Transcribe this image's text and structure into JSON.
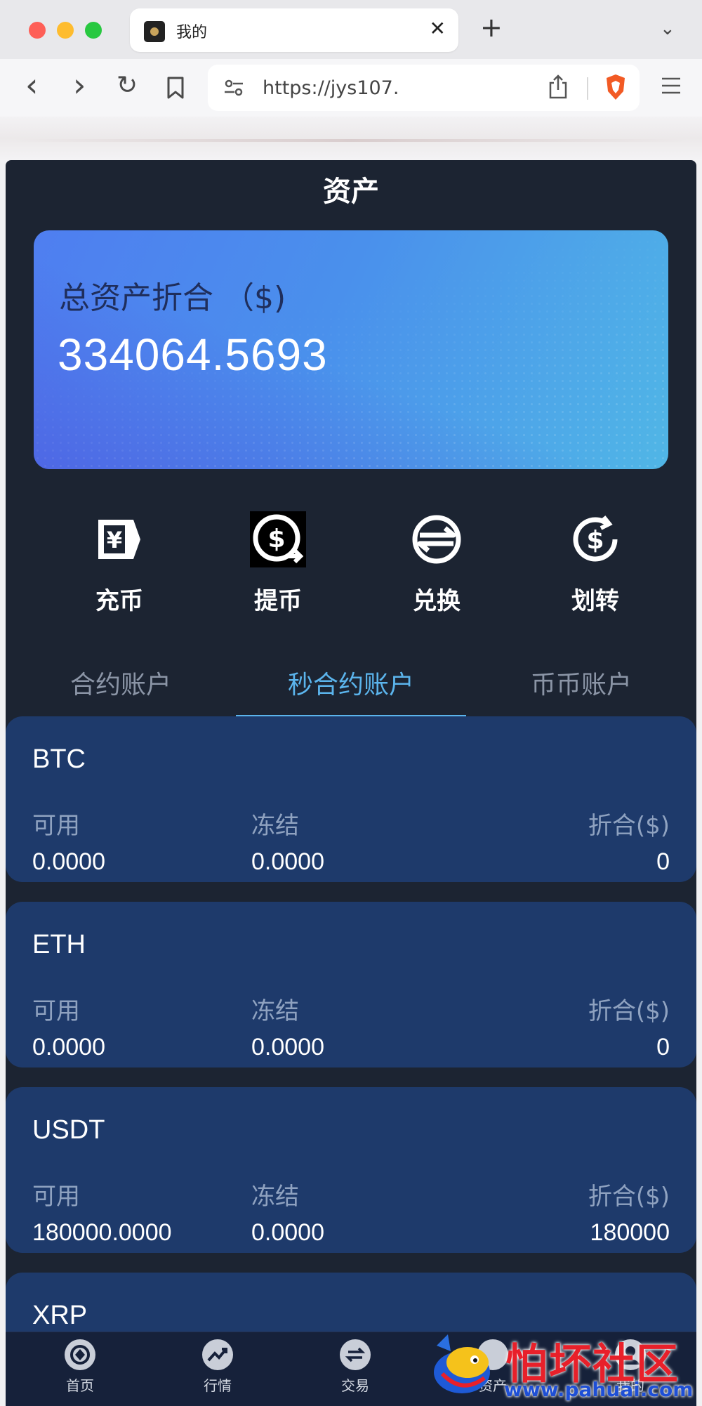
{
  "browser": {
    "tab_title": "我的",
    "close_glyph": "✕",
    "new_tab_glyph": "+",
    "tab_menu_glyph": "⌄",
    "back_glyph": "‹",
    "forward_glyph": "›",
    "reload_glyph": "↻",
    "url": "https://jys107."
  },
  "page": {
    "title": "资产"
  },
  "total": {
    "label": "总资产折合 （$)",
    "value": "334064.5693"
  },
  "actions": [
    {
      "label": "充币",
      "icon": "deposit-icon"
    },
    {
      "label": "提币",
      "icon": "withdraw-icon"
    },
    {
      "label": "兑换",
      "icon": "exchange-icon"
    },
    {
      "label": "划转",
      "icon": "transfer-icon"
    }
  ],
  "account_tabs": [
    {
      "label": "合约账户",
      "active": false
    },
    {
      "label": "秒合约账户",
      "active": true
    },
    {
      "label": "币币账户",
      "active": false
    }
  ],
  "columns": {
    "available": "可用",
    "frozen": "冻结",
    "converted": "折合($)"
  },
  "coins": [
    {
      "name": "BTC",
      "available": "0.0000",
      "frozen": "0.0000",
      "converted": "0"
    },
    {
      "name": "ETH",
      "available": "0.0000",
      "frozen": "0.0000",
      "converted": "0"
    },
    {
      "name": "USDT",
      "available": "180000.0000",
      "frozen": "0.0000",
      "converted": "180000"
    },
    {
      "name": "XRP"
    }
  ],
  "bottom_nav": [
    {
      "label": "首页",
      "icon": "home-icon"
    },
    {
      "label": "行情",
      "icon": "market-icon"
    },
    {
      "label": "交易",
      "icon": "trade-icon"
    },
    {
      "label": "资产",
      "icon": "assets-icon"
    },
    {
      "label": "我的",
      "icon": "profile-icon"
    }
  ],
  "watermark": {
    "title": "怕坏社区",
    "url": "www.pahuai.com"
  },
  "colors": {
    "accent": "#5bb4ec",
    "background": "#1c2432",
    "coin_card": "#1e3a6b",
    "card_gradient_start": "#4f7ef0",
    "card_gradient_end": "#50b6e6"
  }
}
